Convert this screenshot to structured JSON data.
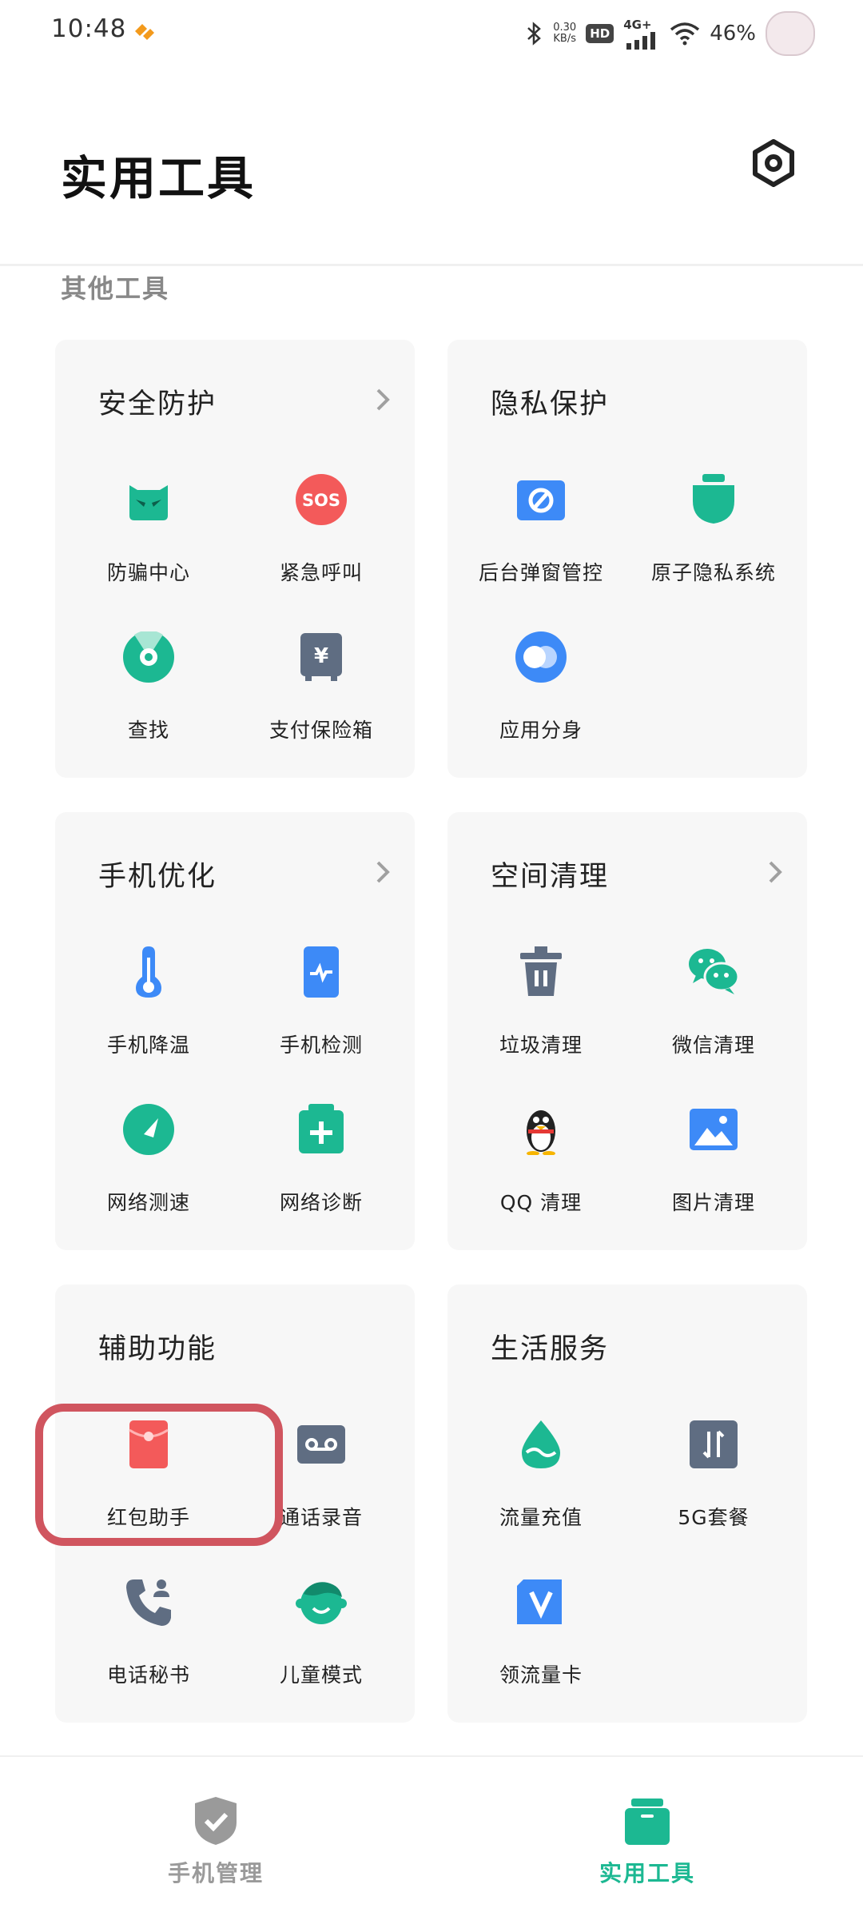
{
  "status_bar": {
    "time": "10:48",
    "net_speed": "0.30",
    "net_speed_unit": "KB/s",
    "hd": "HD",
    "signal": "4G+",
    "battery": "46%"
  },
  "header": {
    "title": "实用工具"
  },
  "section_label": "其他工具",
  "cards": [
    {
      "title": "安全防护",
      "has_chevron": true,
      "items": [
        {
          "label": "防骗中心",
          "icon": "shield-devil-icon",
          "color": "#1cb892"
        },
        {
          "label": "紧急呼叫",
          "icon": "sos-icon",
          "color": "#f35a5a"
        },
        {
          "label": "查找",
          "icon": "find-radar-icon",
          "color": "#1cb892"
        },
        {
          "label": "支付保险箱",
          "icon": "safe-box-icon",
          "color": "#5f6d82"
        }
      ]
    },
    {
      "title": "隐私保护",
      "has_chevron": false,
      "items": [
        {
          "label": "后台弹窗管控",
          "icon": "block-popup-icon",
          "color": "#3d8af7"
        },
        {
          "label": "原子隐私系统",
          "icon": "privacy-system-icon",
          "color": "#1cb892"
        },
        {
          "label": "应用分身",
          "icon": "app-clone-icon",
          "color": "#3d8af7"
        }
      ]
    },
    {
      "title": "手机优化",
      "has_chevron": true,
      "items": [
        {
          "label": "手机降温",
          "icon": "thermometer-icon",
          "color": "#3d8af7"
        },
        {
          "label": "手机检测",
          "icon": "phone-check-icon",
          "color": "#3d8af7"
        },
        {
          "label": "网络测速",
          "icon": "speedometer-icon",
          "color": "#1cb892"
        },
        {
          "label": "网络诊断",
          "icon": "first-aid-icon",
          "color": "#1cb892"
        }
      ]
    },
    {
      "title": "空间清理",
      "has_chevron": true,
      "items": [
        {
          "label": "垃圾清理",
          "icon": "trash-icon",
          "color": "#5f6d82"
        },
        {
          "label": "微信清理",
          "icon": "wechat-icon",
          "color": "#1cb892"
        },
        {
          "label": "QQ 清理",
          "icon": "qq-penguin-icon",
          "color": "#222222"
        },
        {
          "label": "图片清理",
          "icon": "image-icon",
          "color": "#3d8af7"
        }
      ]
    },
    {
      "title": "辅助功能",
      "has_chevron": false,
      "items": [
        {
          "label": "红包助手",
          "icon": "red-envelope-icon",
          "color": "#f35a5a"
        },
        {
          "label": "通话录音",
          "icon": "call-record-icon",
          "color": "#5f6d82"
        },
        {
          "label": "电话秘书",
          "icon": "phone-secretary-icon",
          "color": "#5f6d82"
        },
        {
          "label": "儿童模式",
          "icon": "kid-mode-icon",
          "color": "#1cb892"
        }
      ]
    },
    {
      "title": "生活服务",
      "has_chevron": false,
      "items": [
        {
          "label": "流量充值",
          "icon": "data-drop-icon",
          "color": "#1cb892"
        },
        {
          "label": "5G套餐",
          "icon": "5g-plan-icon",
          "color": "#5f6d82"
        },
        {
          "label": "领流量卡",
          "icon": "v-card-icon",
          "color": "#3d8af7"
        }
      ]
    }
  ],
  "bottom_nav": [
    {
      "label": "手机管理",
      "active": false,
      "color": "#9a9a9a"
    },
    {
      "label": "实用工具",
      "active": true,
      "color": "#1cb892"
    }
  ]
}
